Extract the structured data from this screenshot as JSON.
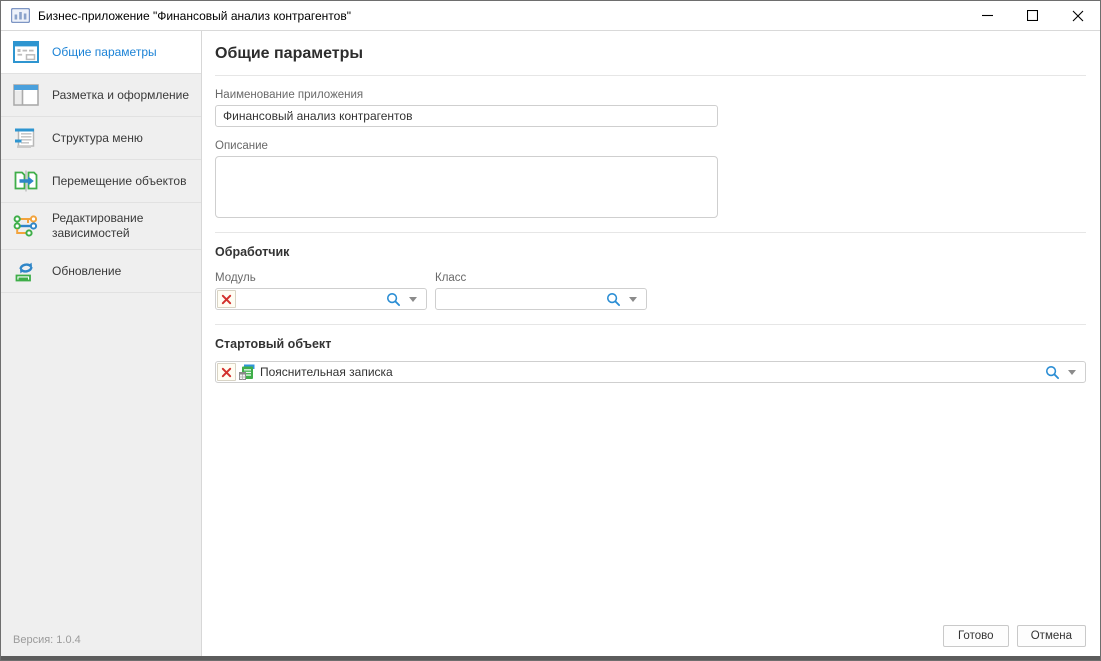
{
  "window": {
    "title": "Бизнес-приложение \"Финансовый анализ контрагентов\""
  },
  "sidebar": {
    "items": [
      {
        "label": "Общие параметры",
        "icon": "form-icon",
        "selected": true
      },
      {
        "label": "Разметка и оформление",
        "icon": "layout-icon",
        "selected": false
      },
      {
        "label": "Структура меню",
        "icon": "menu-structure-icon",
        "selected": false
      },
      {
        "label": "Перемещение объектов",
        "icon": "move-objects-icon",
        "selected": false
      },
      {
        "label": "Редактирование зависимостей",
        "icon": "dependencies-icon",
        "selected": false
      },
      {
        "label": "Обновление",
        "icon": "refresh-icon",
        "selected": false
      }
    ],
    "version": "Версия: 1.0.4"
  },
  "main": {
    "heading": "Общие параметры",
    "fields": {
      "app_name": {
        "label": "Наименование приложения",
        "value": "Финансовый анализ контрагентов"
      },
      "description": {
        "label": "Описание",
        "value": ""
      }
    },
    "handler_section": {
      "title": "Обработчик",
      "module": {
        "label": "Модуль",
        "value": ""
      },
      "class": {
        "label": "Класс",
        "value": ""
      }
    },
    "start_object_section": {
      "title": "Стартовый объект",
      "value": "Пояснительная записка",
      "icon": "report-object-icon"
    },
    "buttons": {
      "done": "Готово",
      "cancel": "Отмена"
    }
  },
  "colors": {
    "accent_blue": "#1c83d6",
    "icon_blue": "#2f95d0",
    "icon_green": "#3fae49",
    "icon_orange": "#f2a33c",
    "clear_red": "#d2322d",
    "sidebar_bg": "#efefef"
  }
}
